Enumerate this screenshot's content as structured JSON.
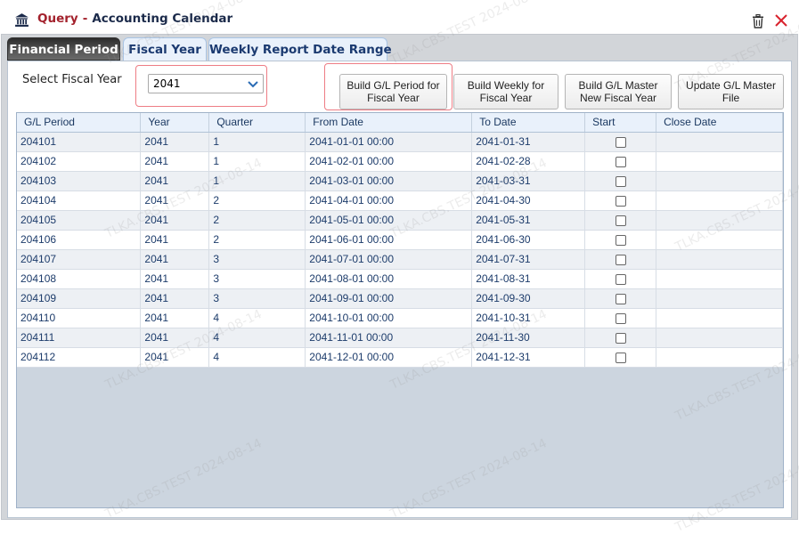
{
  "window": {
    "query_label": "Query",
    "separator": "-",
    "title": "Accounting Calendar",
    "icons": {
      "app": "bank-icon",
      "delete": "trash-icon",
      "close": "close-icon"
    }
  },
  "tabs": [
    {
      "label": "Financial Period",
      "active": true
    },
    {
      "label": "Fiscal Year",
      "active": false
    },
    {
      "label": "Weekly Report Date Range",
      "active": false
    }
  ],
  "form": {
    "select_label": "Select Fiscal Year",
    "fiscal_year_value": "2041"
  },
  "buttons": {
    "build_gl_period": "Build G/L Period for\nFiscal Year",
    "build_weekly": "Build Weekly for\nFiscal Year",
    "build_gl_master": "Build G/L Master\nNew Fiscal Year",
    "update_gl_master": "Update G/L Master\nFile"
  },
  "table": {
    "headers": [
      "G/L Period",
      "Year",
      "Quarter",
      "From Date",
      "To Date",
      "Start",
      "Close Date"
    ],
    "rows": [
      [
        "204101",
        "2041",
        "1",
        "2041-01-01 00:00",
        "2041-01-31",
        "",
        ""
      ],
      [
        "204102",
        "2041",
        "1",
        "2041-02-01 00:00",
        "2041-02-28",
        "",
        ""
      ],
      [
        "204103",
        "2041",
        "1",
        "2041-03-01 00:00",
        "2041-03-31",
        "",
        ""
      ],
      [
        "204104",
        "2041",
        "2",
        "2041-04-01 00:00",
        "2041-04-30",
        "",
        ""
      ],
      [
        "204105",
        "2041",
        "2",
        "2041-05-01 00:00",
        "2041-05-31",
        "",
        ""
      ],
      [
        "204106",
        "2041",
        "2",
        "2041-06-01 00:00",
        "2041-06-30",
        "",
        ""
      ],
      [
        "204107",
        "2041",
        "3",
        "2041-07-01 00:00",
        "2041-07-31",
        "",
        ""
      ],
      [
        "204108",
        "2041",
        "3",
        "2041-08-01 00:00",
        "2041-08-31",
        "",
        ""
      ],
      [
        "204109",
        "2041",
        "3",
        "2041-09-01 00:00",
        "2041-09-30",
        "",
        ""
      ],
      [
        "204110",
        "2041",
        "4",
        "2041-10-01 00:00",
        "2041-10-31",
        "",
        ""
      ],
      [
        "204111",
        "2041",
        "4",
        "2041-11-01 00:00",
        "2041-11-30",
        "",
        ""
      ],
      [
        "204112",
        "2041",
        "4",
        "2041-12-01 00:00",
        "2041-12-31",
        "",
        ""
      ]
    ]
  },
  "watermark_text": "TLKA.CBS.TEST 2024-08-14",
  "colors": {
    "accent": "#a3222d",
    "header_bg": "#e9f1fb",
    "grid_bg": "#ccd5df"
  }
}
